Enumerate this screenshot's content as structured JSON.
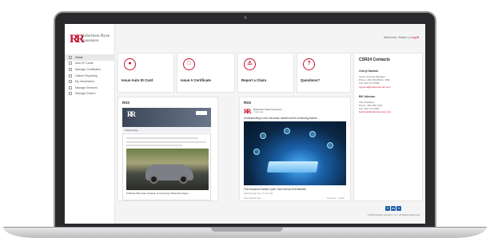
{
  "brand": {
    "logo_mark": "RR",
    "logo_text_1": "Robertson Ryan",
    "logo_text_2": "Insurance",
    "accent": "#c4122f"
  },
  "header": {
    "welcome": "Welcome, Maria!",
    "separator": "|",
    "logout": "Logoff"
  },
  "sidebar": {
    "items": [
      {
        "label": "Home",
        "active": true
      },
      {
        "label": "Auto ID Cards",
        "active": false
      },
      {
        "label": "Manage Certificates",
        "active": false
      },
      {
        "label": "Claims Reporting",
        "active": false
      },
      {
        "label": "My Information",
        "active": false
      },
      {
        "label": "Manage Services",
        "active": false
      },
      {
        "label": "Manage Drivers",
        "active": false
      }
    ]
  },
  "tiles": [
    {
      "label": "Issue Auto ID Card",
      "icon": "car-icon"
    },
    {
      "label": "Issue A Certificate",
      "icon": "document-icon"
    },
    {
      "label": "Report a Claim",
      "icon": "claim-icon"
    },
    {
      "label": "Questions?",
      "icon": "question-icon"
    }
  ],
  "feeds": {
    "left": {
      "title": "RSS",
      "fb_bar": "Follow Page",
      "caption": "5 Minute Why Auto Invasion Is Incoming | Robertson Ryan"
    },
    "right": {
      "title": "RSS",
      "brand": "RR",
      "name": "Robertson Ryan Insurance",
      "date": "2 days ago",
      "text": "Understanding a new insurance market and its continuing factors...",
      "caption": "The Insurance Market Cycle: Hard Versus Soft Markets",
      "meta": "robertsonryan.com • 5 min read",
      "foot_left": "View Original post",
      "foot_right": "Comment · 1 share"
    }
  },
  "contacts": {
    "title": "CSR24 Contacts",
    "people": [
      {
        "name": "Cheryl Gamma",
        "lines": [
          "Senior Account Manager",
          "Phone: 262-790-8002 x 1052",
          "Fax: 262-717-9409"
        ],
        "email": "cgamma@robertsonryan.com"
      },
      {
        "name": "Bill Johnson",
        "lines": [
          "Vice President",
          "Phone: 262-395-7003",
          "Fax: 262-717-9409"
        ],
        "email": "bjohnson@robertsonryan.com"
      }
    ]
  },
  "footer": {
    "social": [
      "f",
      "in",
      "t"
    ],
    "copyright": "©2024 Applied Systems, Inc. All Rights Reserved."
  }
}
